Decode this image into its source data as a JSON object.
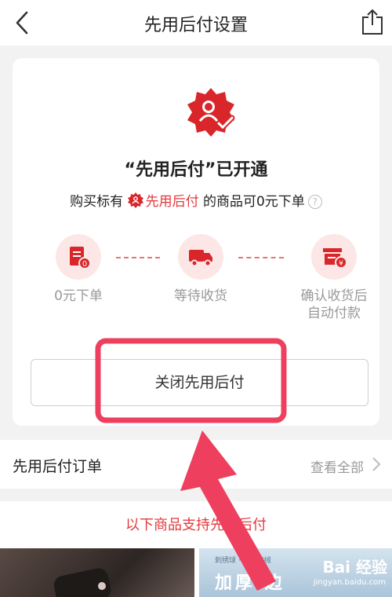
{
  "nav": {
    "title": "先用后付设置"
  },
  "card": {
    "enabled_title": "“先用后付”已开通",
    "desc_prefix": "购买标有",
    "desc_highlight": "先用后付",
    "desc_suffix": "的商品可0元下单",
    "help_symbol": "?",
    "steps": [
      {
        "label": "0元下单",
        "icon": "order-doc-icon"
      },
      {
        "label": "等待收货",
        "icon": "truck-icon"
      },
      {
        "label": "确认收货后自动付款",
        "icon": "payment-box-icon"
      }
    ],
    "close_button": "关闭先用后付"
  },
  "orders": {
    "label": "先用后付订单",
    "view_all": "查看全部"
  },
  "support": {
    "text": "以下商品支持先用后付"
  },
  "products": {
    "item2_small": "刺绣球 · 深度加绒",
    "item2_big": "加厚 边",
    "watermark": "Bai 经验",
    "watermark_url": "jingyan.baidu.com"
  },
  "colors": {
    "accent": "#e4393c",
    "highlight_box": "#ee3f5f"
  }
}
